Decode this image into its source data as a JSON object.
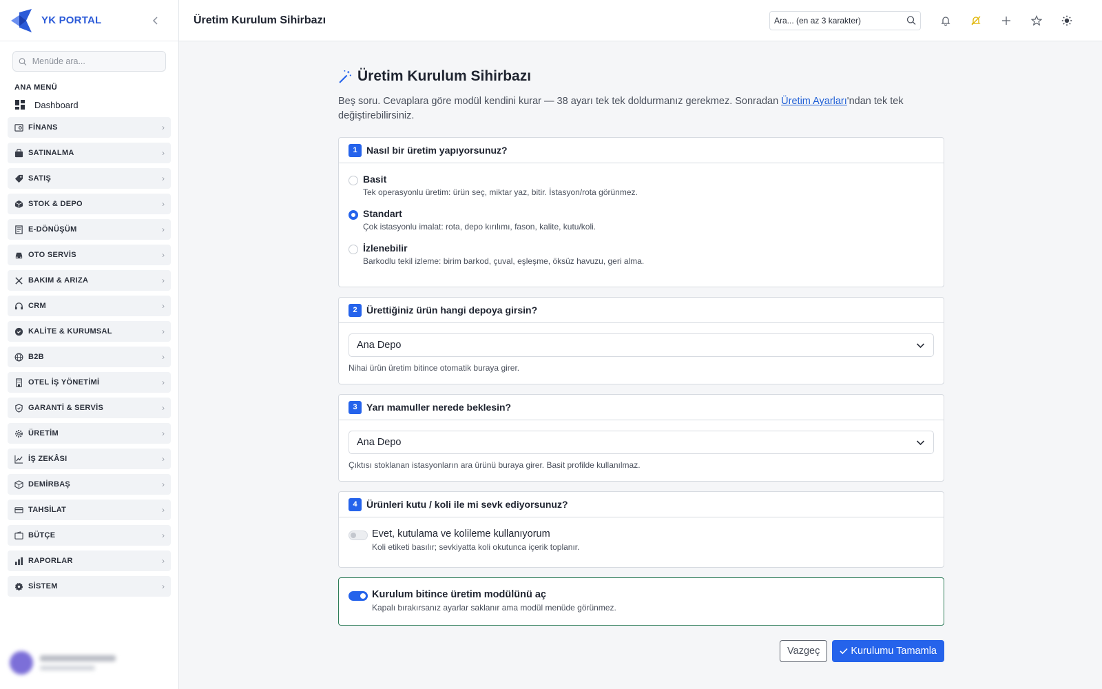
{
  "brand": {
    "name": "YK PORTAL"
  },
  "sidebar": {
    "search_placeholder": "Menüde ara...",
    "section_title": "ANA MENÜ",
    "dashboard_label": "Dashboard",
    "items": [
      {
        "label": "FİNANS",
        "icon": "finance-icon"
      },
      {
        "label": "SATINALMA",
        "icon": "bag-icon"
      },
      {
        "label": "SATIŞ",
        "icon": "tag-icon"
      },
      {
        "label": "STOK & DEPO",
        "icon": "box-icon"
      },
      {
        "label": "E-DÖNÜŞÜM",
        "icon": "document-icon"
      },
      {
        "label": "OTO SERVİS",
        "icon": "car-icon"
      },
      {
        "label": "BAKIM & ARIZA",
        "icon": "tools-icon"
      },
      {
        "label": "CRM",
        "icon": "headset-icon"
      },
      {
        "label": "KALİTE & KURUMSAL",
        "icon": "badge-check-icon"
      },
      {
        "label": "B2B",
        "icon": "globe-icon"
      },
      {
        "label": "OTEL İŞ YÖNETİMİ",
        "icon": "building-icon"
      },
      {
        "label": "GARANTİ & SERVİS",
        "icon": "shield-icon"
      },
      {
        "label": "ÜRETİM",
        "icon": "gear-icon"
      },
      {
        "label": "İŞ ZEKÂSI",
        "icon": "chart-line-icon"
      },
      {
        "label": "DEMİRBAŞ",
        "icon": "cube-icon"
      },
      {
        "label": "TAHSİLAT",
        "icon": "card-icon"
      },
      {
        "label": "BÜTÇE",
        "icon": "wallet-icon"
      },
      {
        "label": "RAPORLAR",
        "icon": "bar-chart-icon"
      },
      {
        "label": "SİSTEM",
        "icon": "cog-icon"
      }
    ]
  },
  "topbar": {
    "title": "Üretim Kurulum Sihirbazı",
    "search_placeholder": "Ara... (en az 3 karakter)"
  },
  "wizard": {
    "title": "Üretim Kurulum Sihirbazı",
    "desc_before": "Beş soru. Cevaplara göre modül kendini kurar — 38 ayarı tek tek doldurmanız gerekmez. Sonradan ",
    "desc_link": "Üretim Ayarları",
    "desc_after": "'ndan tek tek değiştirebilirsiniz.",
    "q1": {
      "num": "1",
      "question": "Nasıl bir üretim yapıyorsunuz?",
      "options": [
        {
          "title": "Basit",
          "sub": "Tek operasyonlu üretim: ürün seç, miktar yaz, bitir. İstasyon/rota görünmez."
        },
        {
          "title": "Standart",
          "sub": "Çok istasyonlu imalat: rota, depo kırılımı, fason, kalite, kutu/koli."
        },
        {
          "title": "İzlenebilir",
          "sub": "Barkodlu tekil izleme: birim barkod, çuval, eşleşme, öksüz havuzu, geri alma."
        }
      ],
      "selected": "Standart"
    },
    "q2": {
      "num": "2",
      "question": "Ürettiğiniz ürün hangi depoya girsin?",
      "value": "Ana Depo",
      "hint": "Nihai ürün üretim bitince otomatik buraya girer."
    },
    "q3": {
      "num": "3",
      "question": "Yarı mamuller nerede beklesin?",
      "value": "Ana Depo",
      "hint": "Çıktısı stoklanan istasyonların ara ürünü buraya girer. Basit profilde kullanılmaz."
    },
    "q4": {
      "num": "4",
      "question": "Ürünleri kutu / koli ile mi sevk ediyorsunuz?",
      "toggle_title": "Evet, kutulama ve kolileme kullanıyorum",
      "toggle_sub": "Koli etiketi basılır; sevkiyatta koli okutunca içerik toplanır.",
      "enabled": false
    },
    "activate": {
      "title": "Kurulum bitince üretim modülünü aç",
      "sub": "Kapalı bırakırsanız ayarlar saklanır ama modül menüde görünmez.",
      "enabled": true
    },
    "cancel_label": "Vazgeç",
    "submit_label": "Kurulumu Tamamla"
  },
  "colors": {
    "accent": "#2563eb",
    "brand": "#2c5bd8",
    "success_border": "#2f7d5a",
    "bell_warning": "#e0b400"
  }
}
